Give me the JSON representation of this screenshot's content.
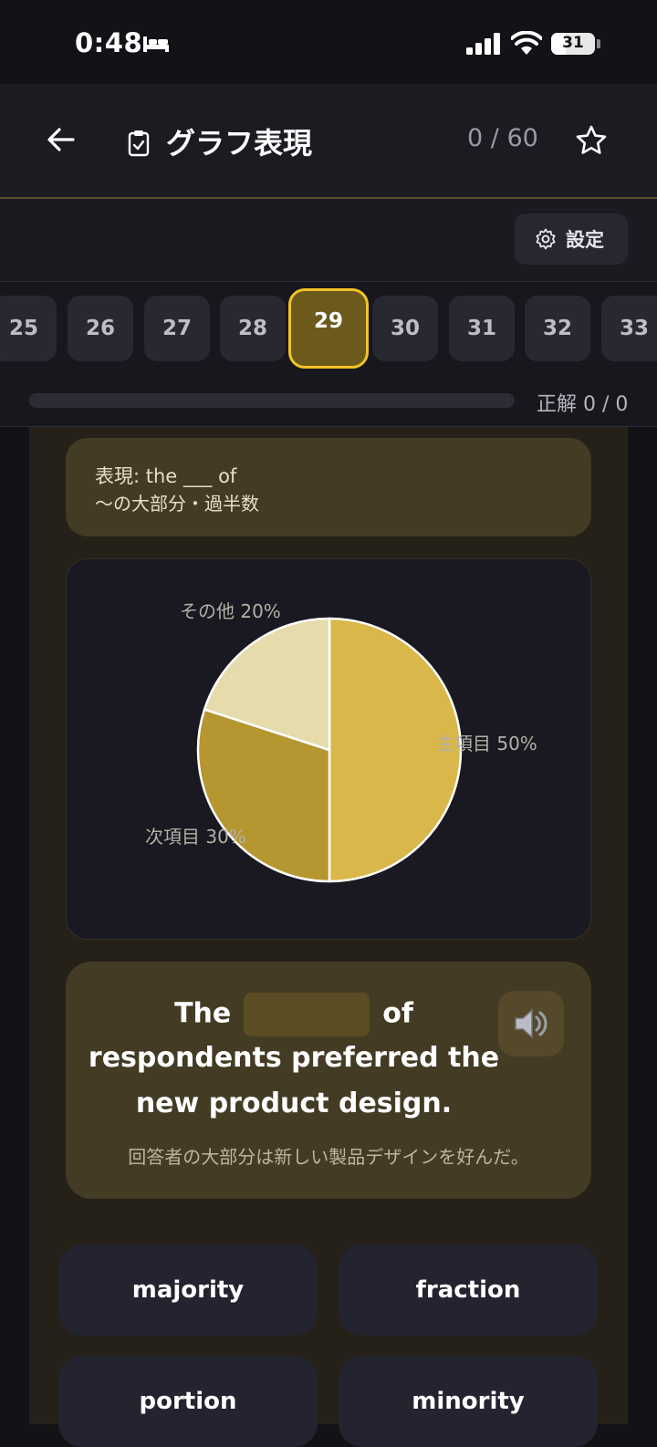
{
  "status_bar": {
    "time": "0:48",
    "battery": "31",
    "sleep_icon": "bed-icon",
    "signal_icon": "signal-icon",
    "wifi_icon": "wifi-icon"
  },
  "header": {
    "title": "グラフ表現",
    "counter": "0 / 60",
    "back_icon": "arrow-left-icon",
    "title_icon": "clipboard-check-icon",
    "favorite_icon": "star-outline-icon"
  },
  "settings": {
    "label": "設定",
    "icon": "gear-icon"
  },
  "question_nav": {
    "items": [
      "25",
      "26",
      "27",
      "28",
      "29",
      "30",
      "31",
      "32",
      "33"
    ],
    "active": "29"
  },
  "progress": {
    "score": "正解 0 / 0",
    "fraction": 0
  },
  "hint": {
    "line1": "表現: the ___ of",
    "line2": "〜の大部分・過半数"
  },
  "chart_data": {
    "type": "pie",
    "slices": [
      {
        "label": "主項目 50%",
        "value": 50,
        "color": "#d9b74a"
      },
      {
        "label": "次項目 30%",
        "value": 30,
        "color": "#b69630"
      },
      {
        "label": "その他 20%",
        "value": 20,
        "color": "#e5dbab"
      }
    ],
    "stroke": "#ffffff",
    "legend": "none"
  },
  "question": {
    "word_before": "The",
    "word_after": "of",
    "line2": "respondents preferred the",
    "line3": "new product design.",
    "translation": "回答者の大部分は新しい製品デザインを好んだ。",
    "audio_icon": "speaker-icon"
  },
  "choices": [
    "majority",
    "fraction",
    "portion",
    "minority"
  ],
  "colors": {
    "accent": "#f3c227",
    "background": "#121217",
    "card": "#433b23"
  }
}
